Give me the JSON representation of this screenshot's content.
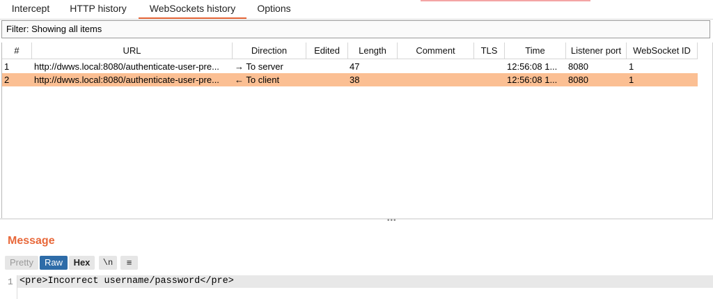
{
  "tabs": {
    "intercept": "Intercept",
    "http_history": "HTTP history",
    "websockets_history": "WebSockets history",
    "options": "Options"
  },
  "filter": {
    "text": "Filter: Showing all items"
  },
  "columns": {
    "num": "#",
    "url": "URL",
    "direction": "Direction",
    "edited": "Edited",
    "length": "Length",
    "comment": "Comment",
    "tls": "TLS",
    "time": "Time",
    "listener_port": "Listener port",
    "websocket_id": "WebSocket ID"
  },
  "rows": [
    {
      "num": "1",
      "url": "http://dwws.local:8080/authenticate-user-pre...",
      "direction": "→ To server",
      "edited": "",
      "length": "47",
      "comment": "",
      "tls": "",
      "time": "12:56:08 1...",
      "listener_port": "8080",
      "websocket_id": "1",
      "selected": false
    },
    {
      "num": "2",
      "url": "http://dwws.local:8080/authenticate-user-pre...",
      "direction": "← To client",
      "edited": "",
      "length": "38",
      "comment": "",
      "tls": "",
      "time": "12:56:08 1...",
      "listener_port": "8080",
      "websocket_id": "1",
      "selected": true
    }
  ],
  "message": {
    "title": "Message",
    "buttons": {
      "pretty": "Pretty",
      "raw": "Raw",
      "hex": "Hex",
      "newline": "\\n",
      "menu": "≡"
    },
    "line_number": "1",
    "content": "<pre>Incorrect username/password</pre>"
  },
  "colors": {
    "accent": "#e8683a",
    "selected_row": "#fbbf93",
    "raw_active": "#2e6ca8"
  }
}
